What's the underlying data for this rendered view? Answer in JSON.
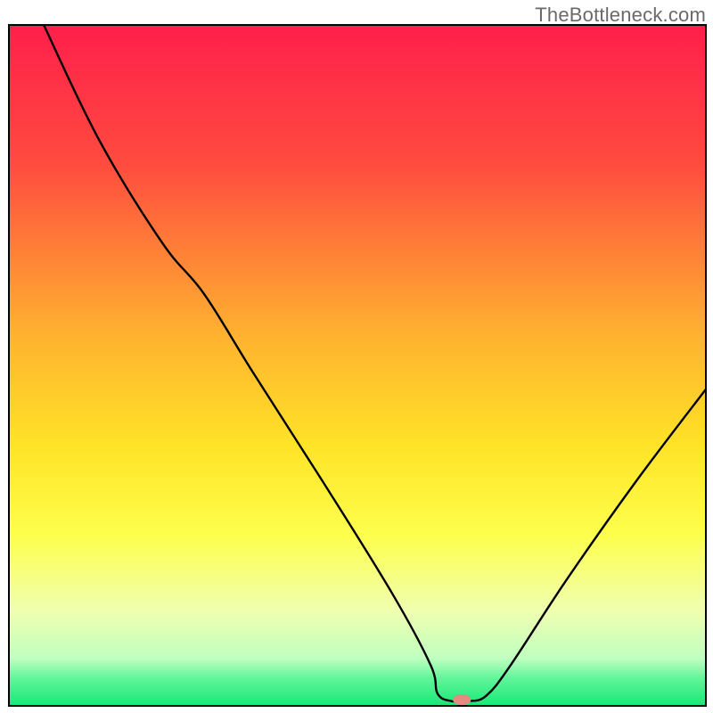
{
  "watermark": "TheBottleneck.com",
  "chart_data": {
    "type": "line",
    "title": "",
    "xlabel": "",
    "ylabel": "",
    "xlim": [
      0,
      100
    ],
    "ylim": [
      0,
      100
    ],
    "gradient_stops": [
      {
        "offset": 0,
        "color": "#ff1f4b"
      },
      {
        "offset": 20,
        "color": "#ff4a3f"
      },
      {
        "offset": 45,
        "color": "#ffb030"
      },
      {
        "offset": 62,
        "color": "#ffe427"
      },
      {
        "offset": 75,
        "color": "#fdff4d"
      },
      {
        "offset": 86,
        "color": "#f0ffb0"
      },
      {
        "offset": 93,
        "color": "#c0ffc0"
      },
      {
        "offset": 96,
        "color": "#60f59a"
      },
      {
        "offset": 100,
        "color": "#17e877"
      }
    ],
    "curve": {
      "name": "bottleneck-curve",
      "points": [
        {
          "x": 5.0,
          "y": 100.0
        },
        {
          "x": 13.0,
          "y": 83.0
        },
        {
          "x": 22.0,
          "y": 68.0
        },
        {
          "x": 28.0,
          "y": 60.5
        },
        {
          "x": 35.0,
          "y": 49.0
        },
        {
          "x": 45.0,
          "y": 33.0
        },
        {
          "x": 55.0,
          "y": 16.5
        },
        {
          "x": 60.5,
          "y": 6.0
        },
        {
          "x": 61.5,
          "y": 1.8
        },
        {
          "x": 63.5,
          "y": 0.7
        },
        {
          "x": 66.0,
          "y": 0.7
        },
        {
          "x": 68.5,
          "y": 1.5
        },
        {
          "x": 72.0,
          "y": 6.0
        },
        {
          "x": 80.0,
          "y": 18.5
        },
        {
          "x": 90.0,
          "y": 33.0
        },
        {
          "x": 100.0,
          "y": 46.5
        }
      ]
    },
    "marker": {
      "x": 65.0,
      "y": 0.9,
      "rx_pct": 1.3,
      "ry_pct": 0.8,
      "color": "#e58a82"
    },
    "frame": {
      "stroke": "#000000",
      "width": 2
    }
  }
}
